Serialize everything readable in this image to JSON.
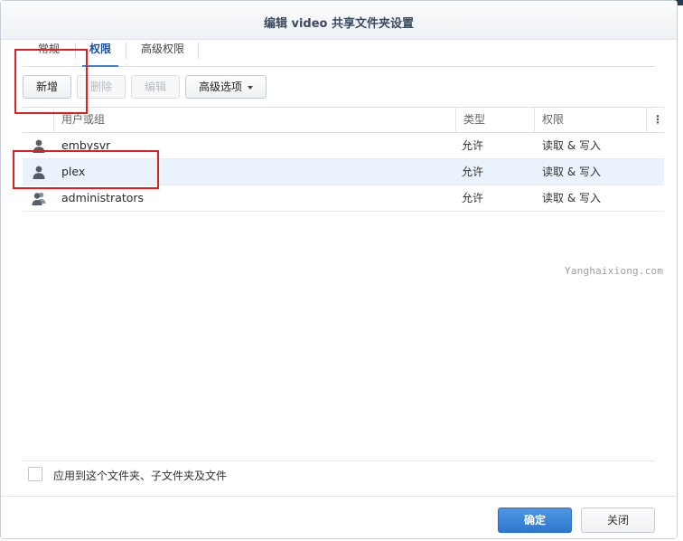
{
  "dialog": {
    "title": "编辑 video 共享文件夹设置"
  },
  "tabs": [
    {
      "label": "常规"
    },
    {
      "label": "权限"
    },
    {
      "label": "高级权限"
    }
  ],
  "toolbar": {
    "add_label": "新增",
    "delete_label": "删除",
    "edit_label": "编辑",
    "advanced_label": "高级选项"
  },
  "table": {
    "headers": {
      "user": "用户或组",
      "type": "类型",
      "permission": "权限"
    },
    "rows": [
      {
        "name": "embysvr",
        "type": "允许",
        "permission": "读取 & 写入",
        "icon": "user-icon"
      },
      {
        "name": "plex",
        "type": "允许",
        "permission": "读取 & 写入",
        "icon": "user-icon"
      },
      {
        "name": "administrators",
        "type": "允许",
        "permission": "读取 & 写入",
        "icon": "group-icon"
      }
    ]
  },
  "watermark": "Yanghaixiong.com",
  "apply_label": "应用到这个文件夹、子文件夹及文件",
  "footer": {
    "ok_label": "确定",
    "close_label": "关闭"
  },
  "colors": {
    "accent": "#3a82d8",
    "highlight": "#e02020",
    "selected_row": "#eaf2fb"
  }
}
